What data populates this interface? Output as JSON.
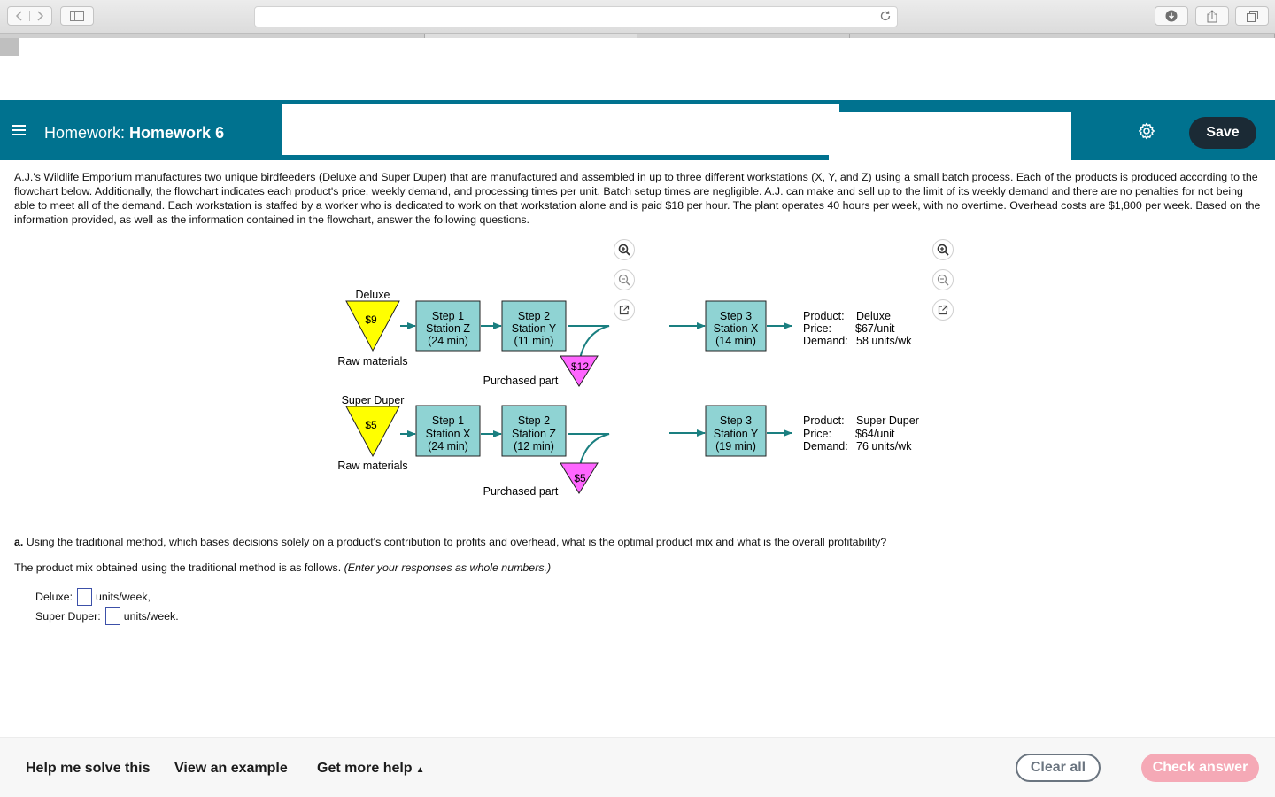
{
  "browser": {
    "back_icon": "chevron-left-icon",
    "forward_icon": "chevron-right-icon",
    "sidebar_icon": "sidebar-icon",
    "reload_icon": "reload-icon",
    "download_icon": "download-icon",
    "share_icon": "share-icon",
    "tabs_icon": "tabs-icon"
  },
  "header": {
    "title_prefix": "Homework:",
    "title_name": "Homework 6",
    "save_label": "Save",
    "accent_color": "#00728f"
  },
  "problem": {
    "text": "A.J.'s Wildlife Emporium manufactures two unique birdfeeders (Deluxe and Super Duper) that are manufactured and assembled in up to three different workstations (X, Y, and Z) using a small batch process. Each of the products is produced according to the flowchart below. Additionally, the flowchart indicates each product's price, weekly demand, and processing times per unit. Batch setup times are negligible. A.J. can make and sell up to the limit of its weekly demand and there are no penalties for not being able to meet all of the demand. Each workstation is staffed by a worker who is dedicated to work on that workstation alone and is paid $18 per hour. The plant operates 40 hours per week, with no overtime. Overhead costs are $1,800 per week. Based on the information provided, as well as the information contained in the flowchart, answer the following questions."
  },
  "flowchart": {
    "deluxe": {
      "name": "Deluxe",
      "raw_cost": "$9",
      "raw_label": "Raw materials",
      "step1": [
        "Step 1",
        "Station Z",
        "(24 min)"
      ],
      "step2": [
        "Step 2",
        "Station Y",
        "(11 min)"
      ],
      "purchased_cost": "$12",
      "purchased_label": "Purchased part",
      "step3": [
        "Step 3",
        "Station X",
        "(14 min)"
      ],
      "product_key": "Product:",
      "product_val": "Deluxe",
      "price_key": "Price:",
      "price_val": "$67/unit",
      "demand_key": "Demand:",
      "demand_val": "58 units/wk"
    },
    "superduper": {
      "name": "Super Duper",
      "raw_cost": "$5",
      "raw_label": "Raw materials",
      "step1": [
        "Step 1",
        "Station X",
        "(24 min)"
      ],
      "step2": [
        "Step 2",
        "Station Z",
        "(12 min)"
      ],
      "purchased_cost": "$5",
      "purchased_label": "Purchased part",
      "step3": [
        "Step 3",
        "Station Y",
        "(19 min)"
      ],
      "product_key": "Product:",
      "product_val": "Super Duper",
      "price_key": "Price:",
      "price_val": "$64/unit",
      "demand_key": "Demand:",
      "demand_val": "76 units/wk"
    },
    "colors": {
      "raw": "#ffff00",
      "station": "#8fd3d3",
      "purchased": "#ff66ff",
      "arrow": "#1a7f80"
    }
  },
  "question": {
    "part_a_label": "a.",
    "part_a_text": "Using the traditional method, which bases decisions solely on a product's contribution to profits and overhead, what is the optimal product mix and what is the overall profitability?",
    "mix_text": "The product mix obtained using the traditional method is as follows.",
    "mix_hint": "(Enter your responses as whole numbers.)",
    "deluxe_label": "Deluxe:",
    "deluxe_value": "",
    "deluxe_unit": "units/week,",
    "superduper_label": "Super Duper:",
    "superduper_value": "",
    "superduper_unit": "units/week."
  },
  "footer": {
    "help_label": "Help me solve this",
    "example_label": "View an example",
    "more_help_label": "Get more help",
    "more_help_caret": "▲",
    "clear_label": "Clear all",
    "check_label": "Check answer"
  }
}
